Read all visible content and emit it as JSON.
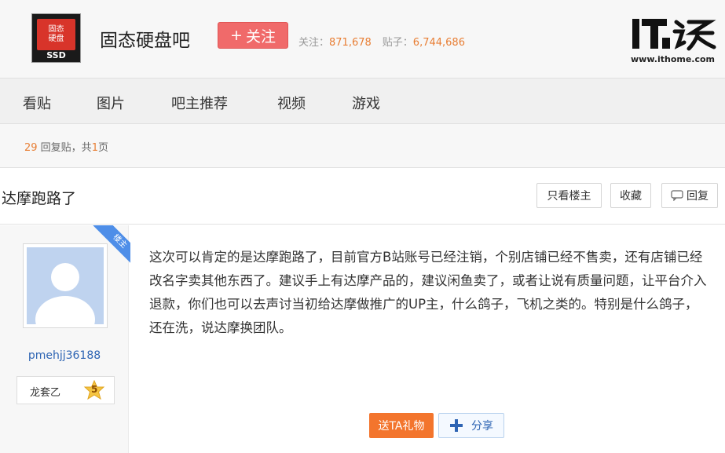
{
  "header": {
    "logo_text_top": "固态",
    "logo_text_mid": "硬盘",
    "logo_text_bottom": "SSD",
    "forum_name": "固态硬盘吧",
    "follow_label": "关注",
    "follow_plus": "+",
    "followers_label": "关注：",
    "followers_count": "871,678",
    "posts_label": "贴子：",
    "posts_count": "6,744,686",
    "ithome_logo_text": "IT之家",
    "ithome_url": "www.ithome.com"
  },
  "nav": {
    "items": [
      {
        "label": "看贴"
      },
      {
        "label": "图片"
      },
      {
        "label": "吧主推荐"
      },
      {
        "label": "视频"
      },
      {
        "label": "游戏"
      }
    ]
  },
  "reply_info": {
    "count": "29",
    "count_suffix": " 回复贴，共",
    "pages": "1",
    "pages_suffix": "页"
  },
  "thread": {
    "title": "达摩跑路了",
    "only_owner_label": "只看楼主",
    "favorite_label": "收藏",
    "reply_label": "回复"
  },
  "post": {
    "corner_label": "楼主",
    "username": "pmehjj36188",
    "level_title": "龙套乙",
    "level_number": "5",
    "content": "这次可以肯定的是达摩跑路了，目前官方B站账号已经注销，个别店铺已经不售卖，还有店铺已经改名字卖其他东西了。建议手上有达摩产品的，建议闲鱼卖了，或者让说有质量问题，让平台介入退款，你们也可以去声讨当初给达摩做推广的UP主，什么鸽子，飞机之类的。特别是什么鸽子，还在洗，说达摩换团队。",
    "gift_label": "送TA礼物",
    "share_label": "分享"
  },
  "colors": {
    "accent_orange": "#e87e34",
    "follow_red": "#f06a6a",
    "link_blue": "#2d64b3",
    "gift_orange": "#f3752d",
    "corner_blue": "#4e8ee8"
  }
}
